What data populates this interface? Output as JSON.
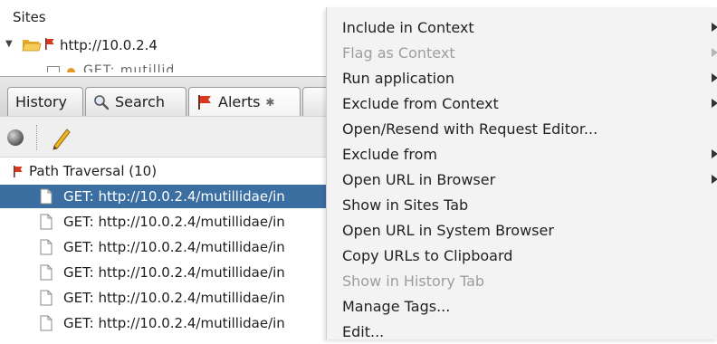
{
  "sites_panel": {
    "title": "Sites",
    "root_node": "http://10.0.2.4",
    "clipped_node": "GET: mutillid"
  },
  "tabs": [
    {
      "label": "History"
    },
    {
      "label": "Search",
      "icon": "magnifier-icon"
    },
    {
      "label": "Alerts",
      "icon": "flag-icon",
      "pinned": true
    }
  ],
  "alerts": {
    "group_label": "Path Traversal (10)",
    "rows": [
      "GET: http://10.0.2.4/mutillidae/in",
      "GET: http://10.0.2.4/mutillidae/in",
      "GET: http://10.0.2.4/mutillidae/in",
      "GET: http://10.0.2.4/mutillidae/in",
      "GET: http://10.0.2.4/mutillidae/in",
      "GET: http://10.0.2.4/mutillidae/in"
    ]
  },
  "context_menu": {
    "items": [
      {
        "label": "Include in Context",
        "submenu": true,
        "enabled": true
      },
      {
        "label": "Flag as Context",
        "submenu": true,
        "enabled": false
      },
      {
        "label": "Run application",
        "submenu": true,
        "enabled": true
      },
      {
        "label": "Exclude from Context",
        "submenu": true,
        "enabled": true
      },
      {
        "label": "Open/Resend with Request Editor...",
        "submenu": false,
        "enabled": true
      },
      {
        "label": "Exclude from",
        "submenu": true,
        "enabled": true
      },
      {
        "label": "Open URL in Browser",
        "submenu": true,
        "enabled": true
      },
      {
        "label": "Show in Sites Tab",
        "submenu": false,
        "enabled": true
      },
      {
        "label": "Open URL in System Browser",
        "submenu": false,
        "enabled": true
      },
      {
        "label": "Copy URLs to Clipboard",
        "submenu": false,
        "enabled": true
      },
      {
        "label": "Show in History Tab",
        "submenu": false,
        "enabled": false
      },
      {
        "label": "Manage Tags...",
        "submenu": false,
        "enabled": true
      },
      {
        "label": "Edit...",
        "submenu": false,
        "enabled": true
      }
    ]
  },
  "colors": {
    "selection": "#3b6ea1",
    "flag": "#d9371f",
    "folder": "#f3c24c",
    "disabled_text": "#9e9e9e"
  }
}
